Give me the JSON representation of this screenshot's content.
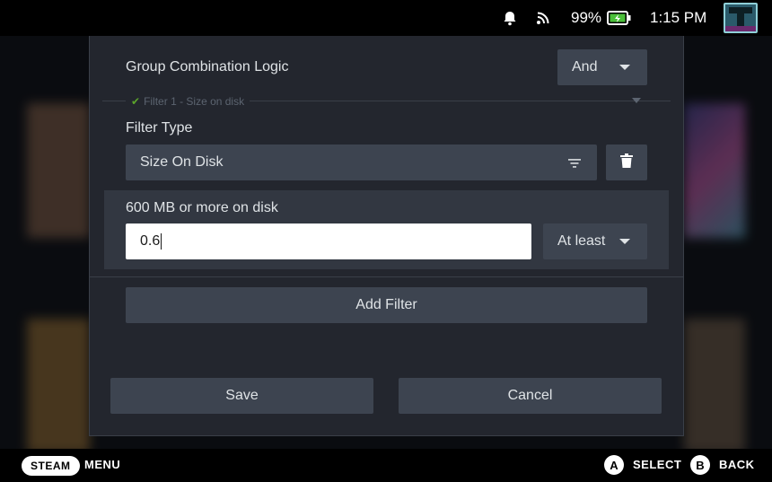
{
  "status_bar": {
    "battery_percent": "99%",
    "time": "1:15 PM",
    "icons": [
      "bell-icon",
      "wifi-icon",
      "battery-charging-icon"
    ]
  },
  "dialog": {
    "group_logic_label": "Group Combination Logic",
    "group_logic_value": "And",
    "filter_section_title": "Filter 1 - Size on disk",
    "filter_type_label": "Filter Type",
    "filter_type_value": "Size On Disk",
    "size_label": "600 MB or more on disk",
    "size_input_value": "0.6",
    "comparison_value": "At least",
    "add_filter_label": "Add Filter",
    "save_label": "Save",
    "cancel_label": "Cancel"
  },
  "hint_bar": {
    "steam_label": "STEAM",
    "menu_label": "MENU",
    "a_key": "A",
    "select_label": "SELECT",
    "b_key": "B",
    "back_label": "BACK"
  },
  "colors": {
    "dialog_bg": "#23262e",
    "control_bg": "#3d4450",
    "highlight_row": "#323741",
    "check_green": "#5ba32b"
  }
}
